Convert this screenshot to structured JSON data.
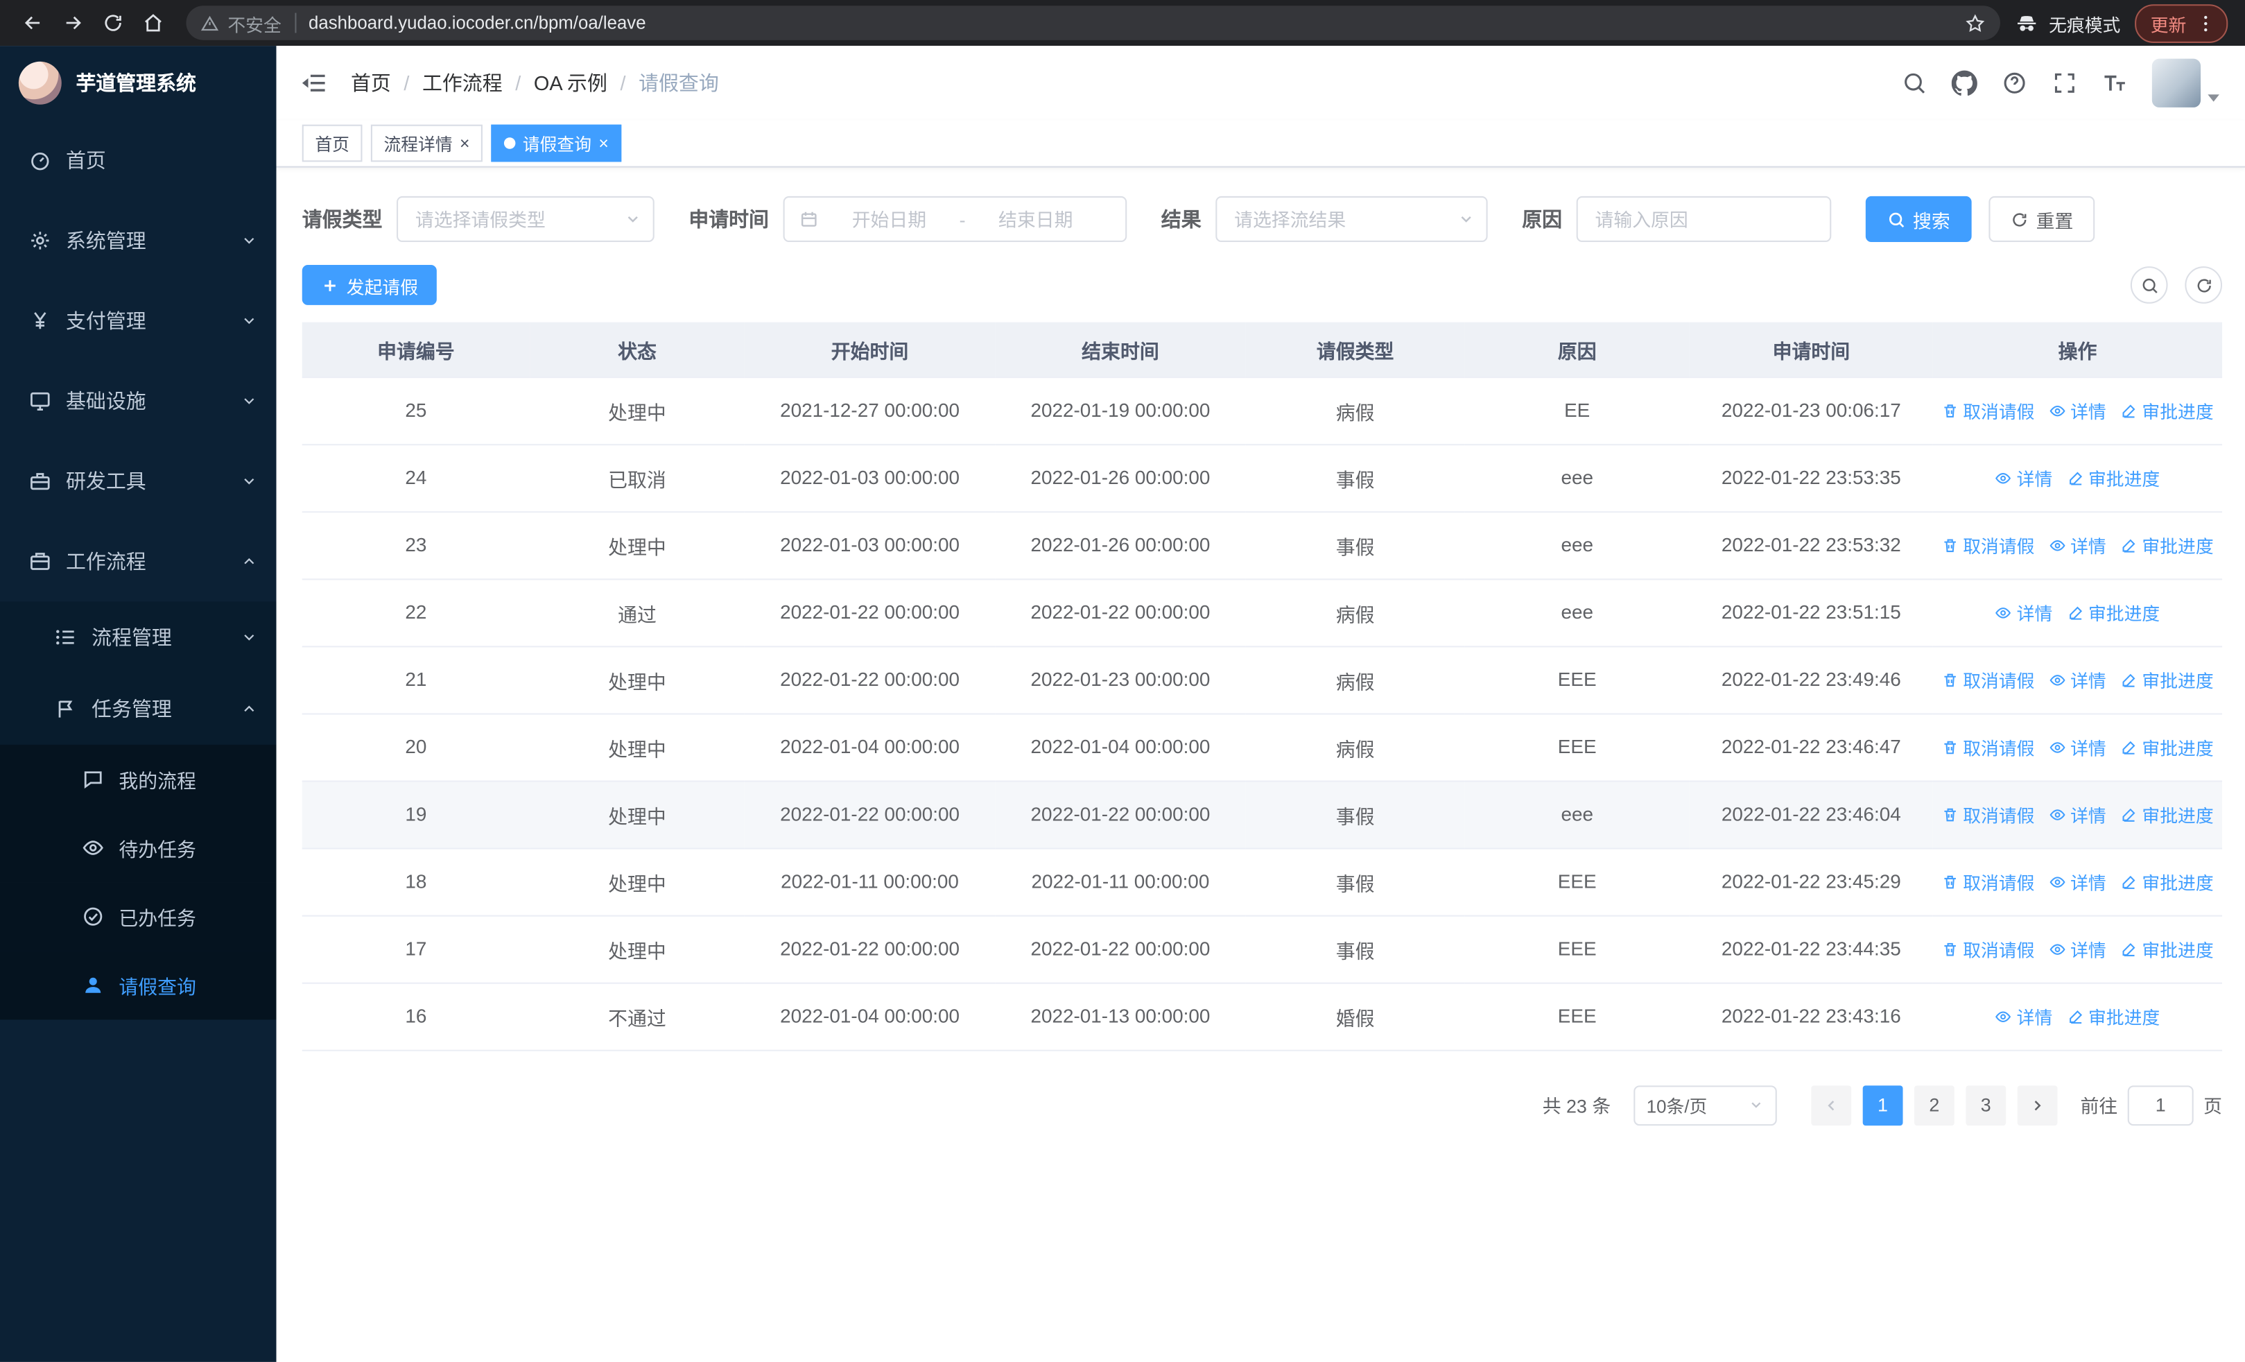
{
  "browser": {
    "security_label": "不安全",
    "url": "dashboard.yudao.iocoder.cn/bpm/oa/leave",
    "incognito_label": "无痕模式",
    "update_label": "更新"
  },
  "sidebar": {
    "title": "芋道管理系统",
    "menu": [
      {
        "label": "首页"
      },
      {
        "label": "系统管理"
      },
      {
        "label": "支付管理"
      },
      {
        "label": "基础设施"
      },
      {
        "label": "研发工具"
      },
      {
        "label": "工作流程"
      }
    ],
    "workflow_children": [
      {
        "label": "流程管理"
      },
      {
        "label": "任务管理"
      }
    ],
    "task_children": [
      {
        "label": "我的流程"
      },
      {
        "label": "待办任务"
      },
      {
        "label": "已办任务"
      },
      {
        "label": "请假查询"
      }
    ]
  },
  "breadcrumb": {
    "items": [
      "首页",
      "工作流程",
      "OA 示例",
      "请假查询"
    ]
  },
  "tabs": [
    {
      "label": "首页"
    },
    {
      "label": "流程详情"
    },
    {
      "label": "请假查询"
    }
  ],
  "filters": {
    "leave_type_label": "请假类型",
    "leave_type_placeholder": "请选择请假类型",
    "apply_time_label": "申请时间",
    "start_date_placeholder": "开始日期",
    "range_separator": "-",
    "end_date_placeholder": "结束日期",
    "result_label": "结果",
    "result_placeholder": "请选择流结果",
    "reason_label": "原因",
    "reason_placeholder": "请输入原因",
    "search_label": "搜索",
    "reset_label": "重置"
  },
  "toolbar": {
    "create_label": "发起请假"
  },
  "table": {
    "columns": [
      "申请编号",
      "状态",
      "开始时间",
      "结束时间",
      "请假类型",
      "原因",
      "申请时间",
      "操作"
    ],
    "action_labels": {
      "cancel": "取消请假",
      "detail": "详情",
      "progress": "审批进度"
    },
    "rows": [
      {
        "id": "25",
        "status": "处理中",
        "start": "2021-12-27 00:00:00",
        "end": "2022-01-19 00:00:00",
        "type": "病假",
        "reason": "EE",
        "applied": "2022-01-23 00:06:17",
        "actions": [
          "cancel",
          "detail",
          "progress"
        ]
      },
      {
        "id": "24",
        "status": "已取消",
        "start": "2022-01-03 00:00:00",
        "end": "2022-01-26 00:00:00",
        "type": "事假",
        "reason": "eee",
        "applied": "2022-01-22 23:53:35",
        "actions": [
          "detail",
          "progress"
        ]
      },
      {
        "id": "23",
        "status": "处理中",
        "start": "2022-01-03 00:00:00",
        "end": "2022-01-26 00:00:00",
        "type": "事假",
        "reason": "eee",
        "applied": "2022-01-22 23:53:32",
        "actions": [
          "cancel",
          "detail",
          "progress"
        ]
      },
      {
        "id": "22",
        "status": "通过",
        "start": "2022-01-22 00:00:00",
        "end": "2022-01-22 00:00:00",
        "type": "病假",
        "reason": "eee",
        "applied": "2022-01-22 23:51:15",
        "actions": [
          "detail",
          "progress"
        ]
      },
      {
        "id": "21",
        "status": "处理中",
        "start": "2022-01-22 00:00:00",
        "end": "2022-01-23 00:00:00",
        "type": "病假",
        "reason": "EEE",
        "applied": "2022-01-22 23:49:46",
        "actions": [
          "cancel",
          "detail",
          "progress"
        ]
      },
      {
        "id": "20",
        "status": "处理中",
        "start": "2022-01-04 00:00:00",
        "end": "2022-01-04 00:00:00",
        "type": "病假",
        "reason": "EEE",
        "applied": "2022-01-22 23:46:47",
        "actions": [
          "cancel",
          "detail",
          "progress"
        ]
      },
      {
        "id": "19",
        "status": "处理中",
        "start": "2022-01-22 00:00:00",
        "end": "2022-01-22 00:00:00",
        "type": "事假",
        "reason": "eee",
        "applied": "2022-01-22 23:46:04",
        "actions": [
          "cancel",
          "detail",
          "progress"
        ],
        "highlighted": true
      },
      {
        "id": "18",
        "status": "处理中",
        "start": "2022-01-11 00:00:00",
        "end": "2022-01-11 00:00:00",
        "type": "事假",
        "reason": "EEE",
        "applied": "2022-01-22 23:45:29",
        "actions": [
          "cancel",
          "detail",
          "progress"
        ]
      },
      {
        "id": "17",
        "status": "处理中",
        "start": "2022-01-22 00:00:00",
        "end": "2022-01-22 00:00:00",
        "type": "事假",
        "reason": "EEE",
        "applied": "2022-01-22 23:44:35",
        "actions": [
          "cancel",
          "detail",
          "progress"
        ]
      },
      {
        "id": "16",
        "status": "不通过",
        "start": "2022-01-04 00:00:00",
        "end": "2022-01-13 00:00:00",
        "type": "婚假",
        "reason": "EEE",
        "applied": "2022-01-22 23:43:16",
        "actions": [
          "detail",
          "progress"
        ]
      }
    ]
  },
  "pagination": {
    "total_label": "共 23 条",
    "page_size_label": "10条/页",
    "pages": [
      "1",
      "2",
      "3"
    ],
    "active_page": "1",
    "goto_label": "前往",
    "goto_value": "1",
    "unit_label": "页"
  },
  "colors": {
    "primary": "#409eff",
    "sidebar_bg": "#0c2135",
    "table_header_bg": "#eef1f6"
  }
}
